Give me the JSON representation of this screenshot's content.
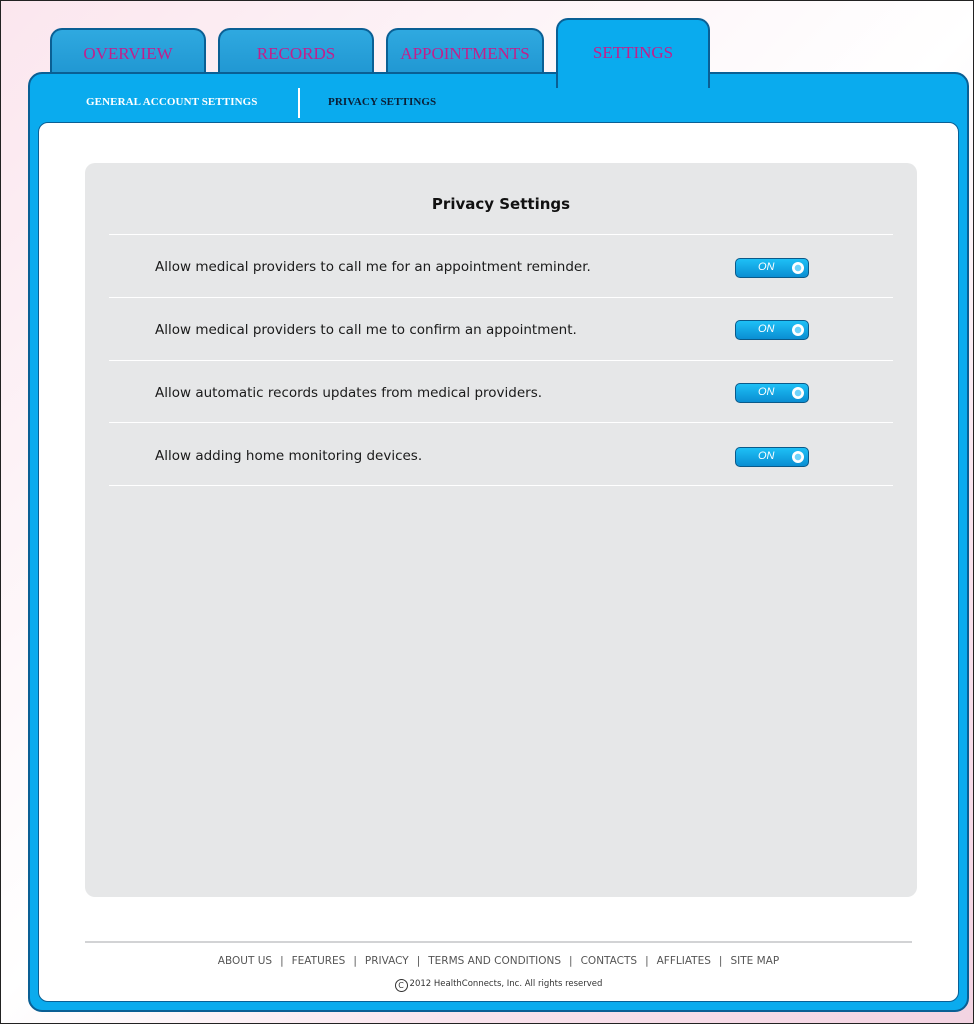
{
  "tabs": [
    {
      "label": "OVERVIEW",
      "active": false
    },
    {
      "label": "RECORDS",
      "active": false
    },
    {
      "label": "APPOINTMENTS",
      "active": false
    },
    {
      "label": "SETTINGS",
      "active": true
    }
  ],
  "subtabs": [
    {
      "label": "GENERAL ACCOUNT SETTINGS",
      "active": false
    },
    {
      "label": "PRIVACY SETTINGS",
      "active": true
    }
  ],
  "privacy": {
    "title": "Privacy Settings",
    "settings": [
      {
        "label": "Allow medical providers to call me for an appointment reminder.",
        "state": "ON"
      },
      {
        "label": "Allow medical providers to call me to confirm an appointment.",
        "state": "ON"
      },
      {
        "label": "Allow automatic records updates from medical providers.",
        "state": "ON"
      },
      {
        "label": "Allow adding home monitoring devices.",
        "state": "ON"
      }
    ]
  },
  "footer": {
    "links": [
      "ABOUT US",
      "FEATURES",
      "PRIVACY",
      "TERMS AND CONDITIONS",
      "CONTACTS",
      "AFFLIATES",
      "SITE MAP"
    ],
    "copyright_symbol": "C",
    "copyright": "2012 HealthConnects, Inc.  All rights reserved"
  },
  "colors": {
    "accent_blue": "#0aabee",
    "border_blue": "#0a5f94",
    "tab_text_magenta": "#c21f8c",
    "content_gray": "#e6e7e8"
  },
  "icons": {
    "toggle_knob": "toggle-knob-icon",
    "copyright": "copyright-icon"
  }
}
